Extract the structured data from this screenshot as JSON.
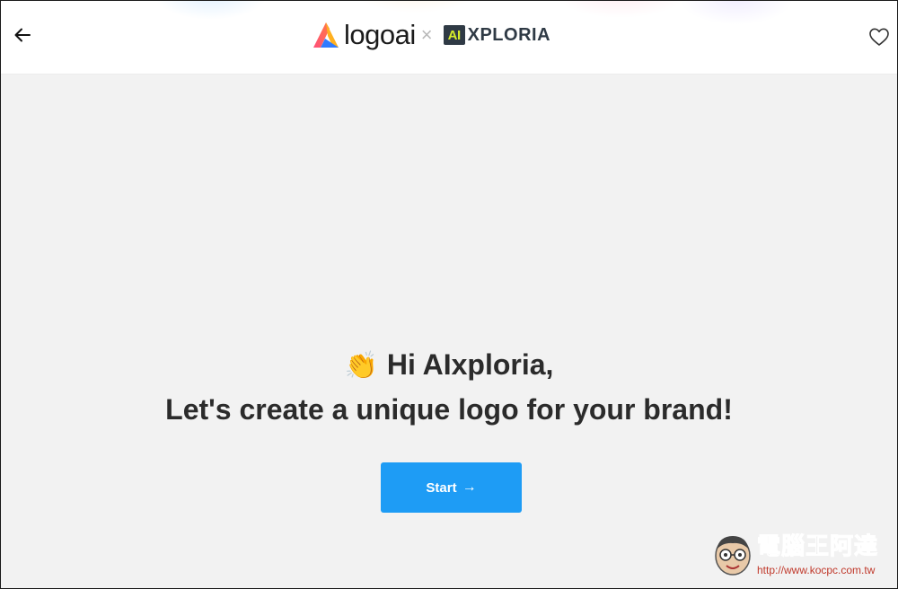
{
  "header": {
    "back_icon": "arrow-left-icon",
    "brand": {
      "logoai_word": "logoai",
      "separator": "×",
      "partner_mark": "AI",
      "partner_word": "XPLORIA"
    },
    "favorite_icon": "heart-outline-icon"
  },
  "main": {
    "greeting_emoji": "👏",
    "greeting": "Hi AIxploria,",
    "tagline": "Let's create a unique logo for your brand!",
    "start_button": {
      "label": "Start",
      "icon": "arrow-right-icon",
      "arrow_glyph": "→"
    }
  },
  "watermark": {
    "title": "電腦王阿達",
    "url": "http://www.kocpc.com.tw"
  },
  "colors": {
    "page_background": "#f2f2f2",
    "header_background": "#ffffff",
    "primary_button": "#1e9cf5",
    "heading_text": "#2b2b2b",
    "partner_dark": "#2f3a45",
    "partner_accent": "#d6ec2a"
  }
}
